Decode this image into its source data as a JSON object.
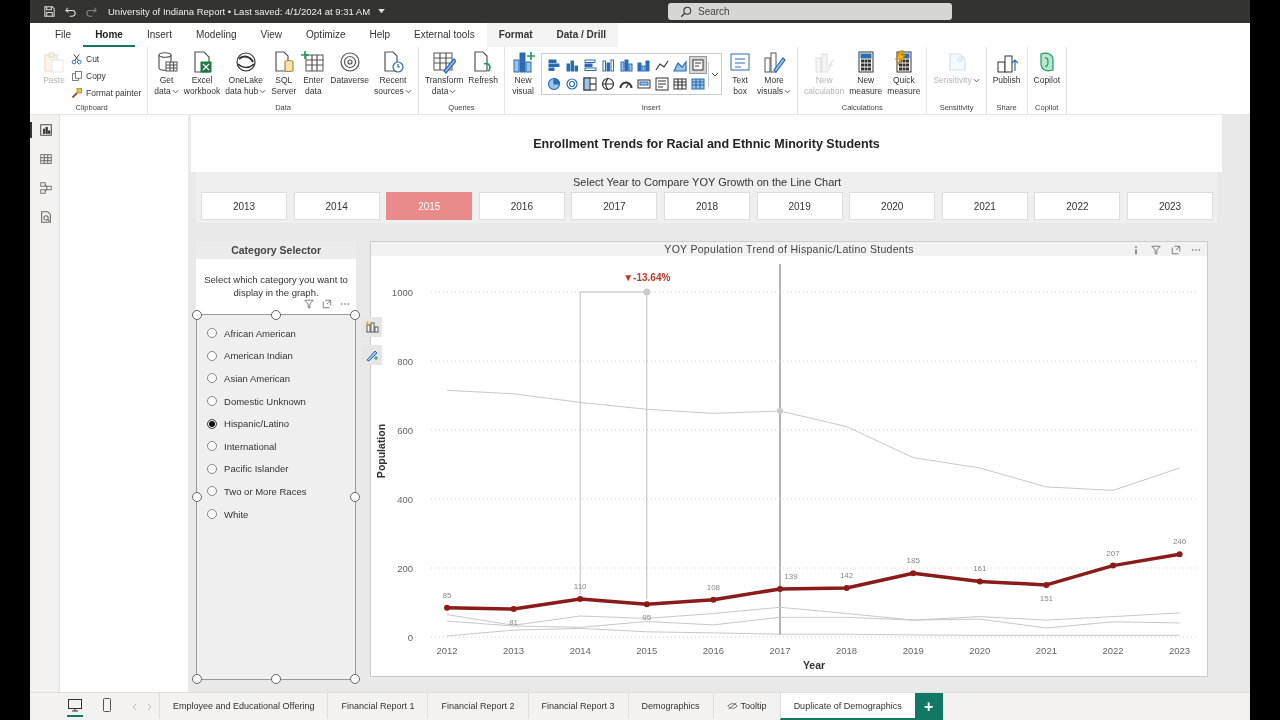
{
  "title_bar": {
    "title": "University of Indiana Report • Last saved: 4/1/2024 at 9:31 AM",
    "search": {
      "placeholder": "Search"
    }
  },
  "menu_tabs": [
    {
      "label": "File",
      "selected": false,
      "contextual": false
    },
    {
      "label": "Home",
      "selected": true,
      "contextual": false
    },
    {
      "label": "Insert",
      "selected": false,
      "contextual": false
    },
    {
      "label": "Modeling",
      "selected": false,
      "contextual": false
    },
    {
      "label": "View",
      "selected": false,
      "contextual": false
    },
    {
      "label": "Optimize",
      "selected": false,
      "contextual": false
    },
    {
      "label": "Help",
      "selected": false,
      "contextual": false
    },
    {
      "label": "External tools",
      "selected": false,
      "contextual": false
    },
    {
      "label": "Format",
      "selected": false,
      "contextual": true
    },
    {
      "label": "Data / Drill",
      "selected": false,
      "contextual": true
    }
  ],
  "ribbon": {
    "groups": [
      {
        "label": "Clipboard",
        "commands": [
          {
            "kind": "large",
            "label": "Paste",
            "disabled": true,
            "dropdown": false
          },
          {
            "kind": "small",
            "label": "Cut",
            "disabled": false
          },
          {
            "kind": "small",
            "label": "Copy",
            "disabled": false
          },
          {
            "kind": "small",
            "label": "Format painter",
            "disabled": false
          }
        ]
      },
      {
        "label": "Data",
        "commands": [
          {
            "kind": "large",
            "label": "Get\ndata",
            "disabled": false,
            "dropdown": true
          },
          {
            "kind": "large",
            "label": "Excel\nworkbook",
            "disabled": false,
            "dropdown": false
          },
          {
            "kind": "large",
            "label": "OneLake\ndata hub",
            "disabled": false,
            "dropdown": true
          },
          {
            "kind": "large",
            "label": "SQL\nServer",
            "disabled": false,
            "dropdown": false
          },
          {
            "kind": "large",
            "label": "Enter\ndata",
            "disabled": false,
            "dropdown": false
          },
          {
            "kind": "large",
            "label": "Dataverse",
            "disabled": false,
            "dropdown": false
          },
          {
            "kind": "large",
            "label": "Recent\nsources",
            "disabled": false,
            "dropdown": true
          }
        ]
      },
      {
        "label": "Queries",
        "commands": [
          {
            "kind": "large",
            "label": "Transform\ndata",
            "disabled": false,
            "dropdown": true
          },
          {
            "kind": "large",
            "label": "Refresh",
            "disabled": false,
            "dropdown": false
          }
        ]
      },
      {
        "label": "Insert",
        "commands": [
          {
            "kind": "large",
            "label": "New\nvisual",
            "disabled": false,
            "dropdown": false
          },
          {
            "kind": "gallery",
            "items": [
              {
                "selected": false
              },
              {
                "selected": false
              },
              {
                "selected": false
              },
              {
                "selected": false
              },
              {
                "selected": false
              },
              {
                "selected": false
              },
              {
                "selected": false
              },
              {
                "selected": false
              },
              {
                "selected": true
              },
              {
                "selected": false
              },
              {
                "selected": false
              },
              {
                "selected": false
              },
              {
                "selected": false
              },
              {
                "selected": false
              },
              {
                "selected": false
              },
              {
                "selected": false
              },
              {
                "selected": false
              },
              {
                "selected": false
              }
            ]
          },
          {
            "kind": "large",
            "label": "Text\nbox",
            "disabled": false,
            "dropdown": false
          },
          {
            "kind": "large",
            "label": "More\nvisuals",
            "disabled": false,
            "dropdown": true
          }
        ]
      },
      {
        "label": "Calculations",
        "commands": [
          {
            "kind": "large",
            "label": "New\ncalculation",
            "disabled": true,
            "dropdown": false
          },
          {
            "kind": "large",
            "label": "New\nmeasure",
            "disabled": false,
            "dropdown": false
          },
          {
            "kind": "large",
            "label": "Quick\nmeasure",
            "disabled": false,
            "dropdown": false
          }
        ]
      },
      {
        "label": "Sensitivity",
        "commands": [
          {
            "kind": "large",
            "label": "Sensitivity",
            "disabled": true,
            "dropdown": true
          }
        ]
      },
      {
        "label": "Share",
        "commands": [
          {
            "kind": "large",
            "label": "Publish",
            "disabled": false,
            "dropdown": false
          }
        ]
      },
      {
        "label": "Copilot",
        "commands": [
          {
            "kind": "large",
            "label": "Copilot",
            "disabled": false,
            "dropdown": false
          }
        ]
      }
    ]
  },
  "view_switcher": [
    {
      "selected": true
    },
    {
      "selected": false
    },
    {
      "selected": false
    },
    {
      "selected": false
    }
  ],
  "report": {
    "title": "Enrollment Trends for Racial and Ethnic Minority Students",
    "year_slicer": {
      "header": "Select Year to Compare YOY Growth on the Line Chart",
      "years": [
        {
          "label": "2013",
          "selected": false
        },
        {
          "label": "2014",
          "selected": false
        },
        {
          "label": "2015",
          "selected": true
        },
        {
          "label": "2016",
          "selected": false
        },
        {
          "label": "2017",
          "selected": false
        },
        {
          "label": "2018",
          "selected": false
        },
        {
          "label": "2019",
          "selected": false
        },
        {
          "label": "2020",
          "selected": false
        },
        {
          "label": "2021",
          "selected": false
        },
        {
          "label": "2022",
          "selected": false
        },
        {
          "label": "2023",
          "selected": false
        }
      ]
    },
    "category_slicer": {
      "title": "Category Selector",
      "description": "Select which category you want to display in the graph.",
      "options": [
        {
          "label": "African American",
          "selected": false
        },
        {
          "label": "American Indian",
          "selected": false
        },
        {
          "label": "Asian American",
          "selected": false
        },
        {
          "label": "Domestic Unknown",
          "selected": false
        },
        {
          "label": "Hispanic/Latino",
          "selected": true
        },
        {
          "label": "International",
          "selected": false
        },
        {
          "label": "Pacific Islander",
          "selected": false
        },
        {
          "label": "Two or More Races",
          "selected": false
        },
        {
          "label": "White",
          "selected": false
        }
      ]
    },
    "line_chart": {
      "yoy_label": "▼-13.64%",
      "chart_data": {
        "type": "line",
        "title": "YOY Population Trend of Hispanic/Latino Students",
        "xlabel": "Year",
        "ylabel": "Population",
        "categories": [
          "2012",
          "2013",
          "2014",
          "2015",
          "2016",
          "2017",
          "2018",
          "2019",
          "2020",
          "2021",
          "2022",
          "2023"
        ],
        "series": [
          {
            "color": "#8b1a1a",
            "marker": "circle",
            "values": [
              85,
              81,
              110,
              95,
              108,
              139,
              142,
              185,
              161,
              151,
              207,
              240
            ],
            "value_labels": [
              "85",
              "81",
              "110",
              "95",
              "108",
              "139",
              "142",
              "185",
              "161",
              "151",
              "207",
              "240"
            ]
          },
          {
            "color": "#c8c8c8",
            "values": [
              715,
              705,
              680,
              660,
              648,
              655,
              610,
              520,
              490,
              435,
              425,
              490
            ]
          },
          {
            "color": "#c8c8c8",
            "values": [
              65,
              34,
              61,
              54,
              68,
              86,
              68,
              49,
              59,
              49,
              59,
              70
            ]
          },
          {
            "color": "#c8c8c8",
            "values": [
              46,
              32,
              28,
              45,
              35,
              57,
              57,
              49,
              52,
              26,
              44,
              41
            ]
          },
          {
            "color": "#c8c8c8",
            "values": [
              3,
              20,
              25,
              15,
              12,
              8,
              8,
              6,
              5,
              5,
              5,
              5
            ]
          }
        ],
        "ylim": [
          0,
          1000
        ],
        "yticks": [
          0,
          200,
          400,
          600,
          800,
          1000
        ],
        "grid": true
      },
      "hovered": [
        false,
        false,
        false,
        false,
        false,
        true,
        false,
        false,
        false,
        false,
        false,
        false
      ]
    }
  },
  "page_tabs": [
    {
      "label": "Employee and Educational Offering",
      "selected": false,
      "hidden": false
    },
    {
      "label": "Financial Report 1",
      "selected": false,
      "hidden": false
    },
    {
      "label": "Financial Report 2",
      "selected": false,
      "hidden": false
    },
    {
      "label": "Financial Report 3",
      "selected": false,
      "hidden": false
    },
    {
      "label": "Demographics",
      "selected": false,
      "hidden": false
    },
    {
      "label": "Tooltip",
      "selected": false,
      "hidden": true
    },
    {
      "label": "Duplicate of Demographics",
      "selected": true,
      "hidden": false
    }
  ],
  "add_page": "+"
}
